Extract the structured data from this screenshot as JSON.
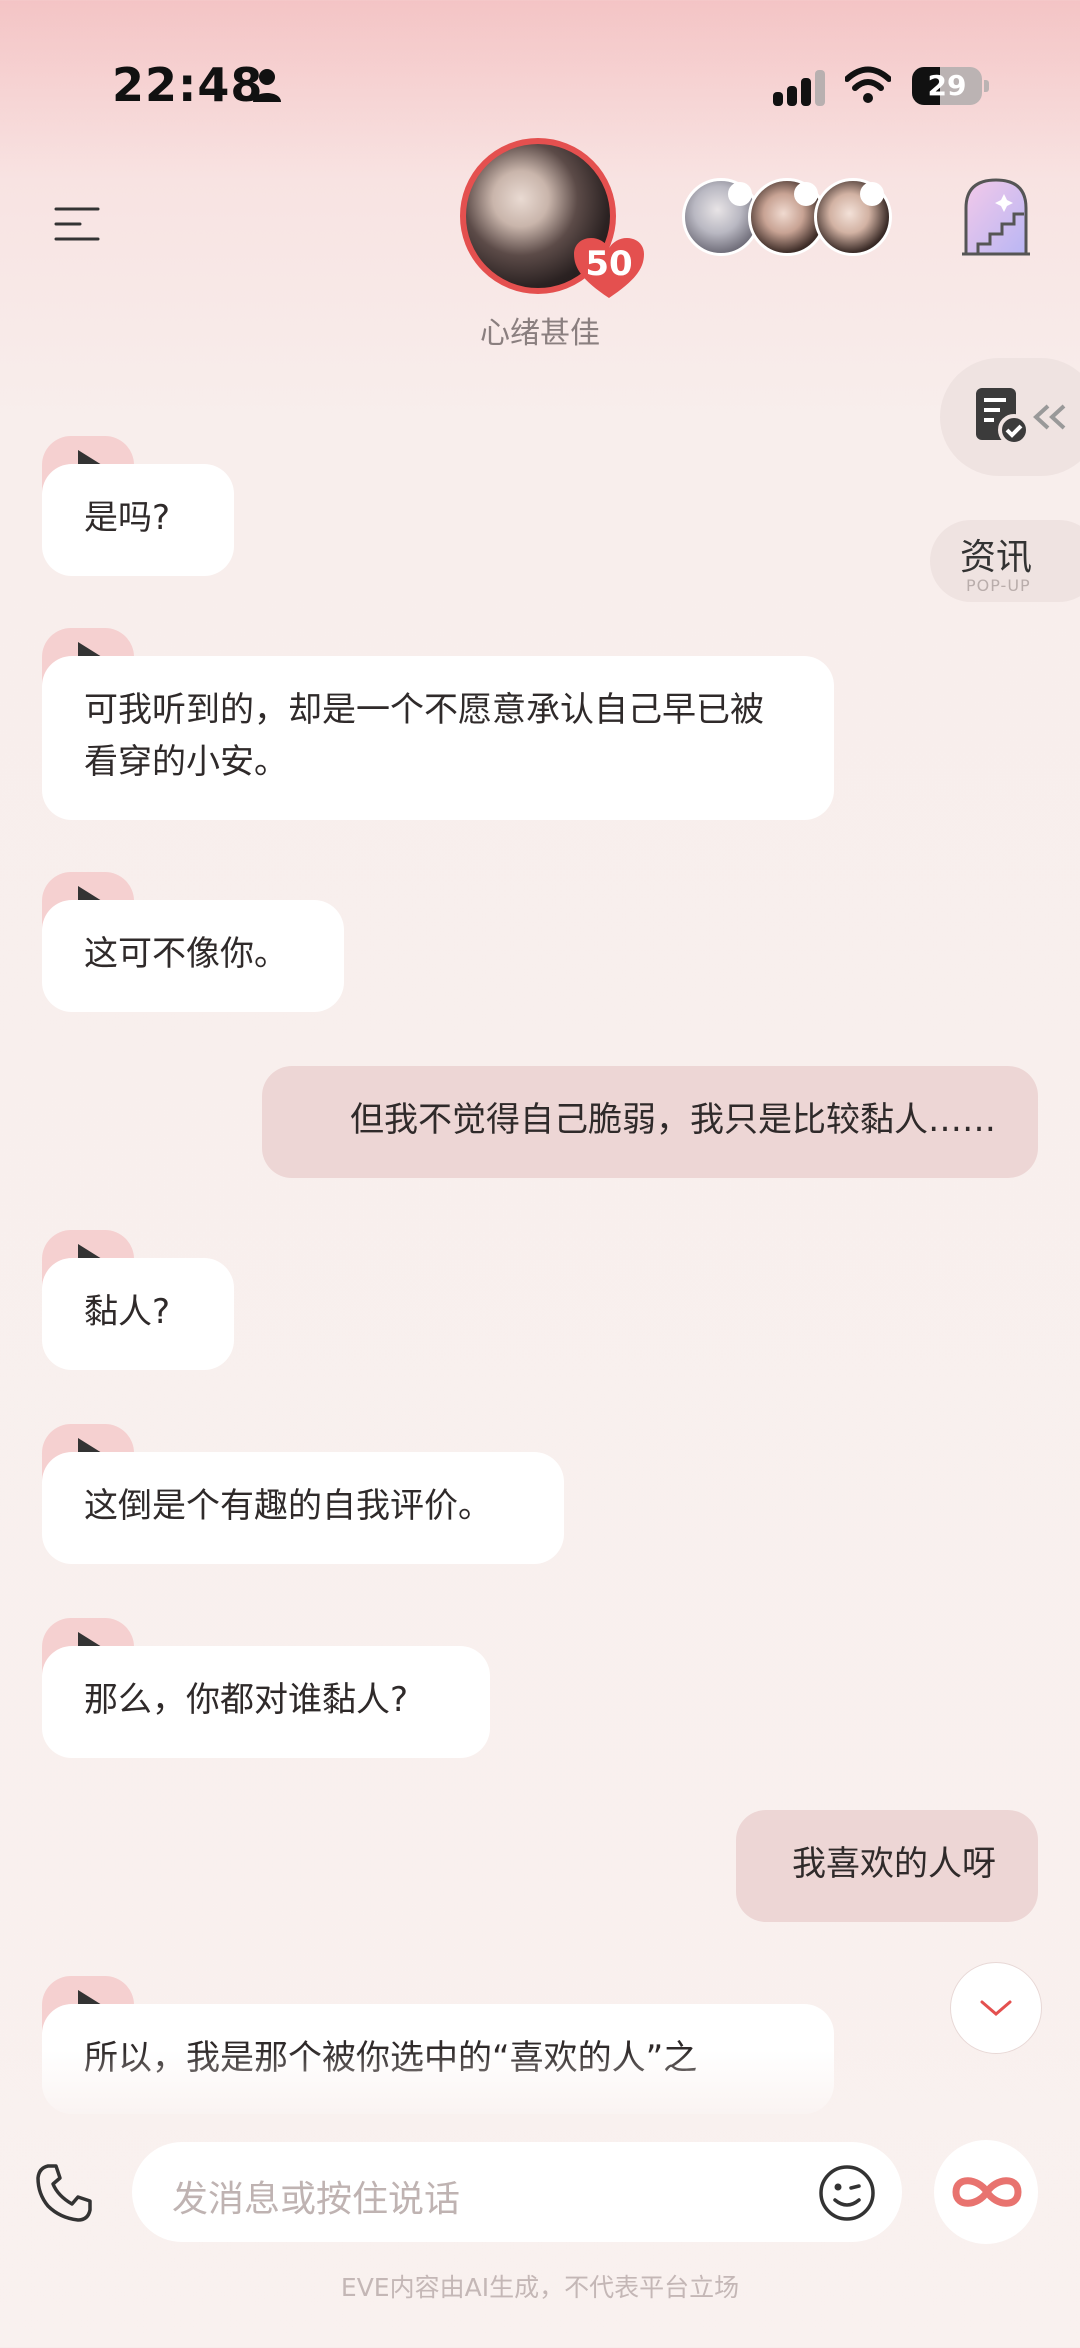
{
  "status_bar": {
    "time": "22:48",
    "battery": "29"
  },
  "header": {
    "affinity": "50",
    "mood": "心绪甚佳"
  },
  "side": {
    "news_label": "资讯",
    "news_sub": "POP-UP"
  },
  "messages": [
    {
      "role": "ai",
      "text": "是吗?"
    },
    {
      "role": "ai",
      "text": "可我听到的，却是一个不愿意承认自己早已被看穿的小安。"
    },
    {
      "role": "ai",
      "text": "这可不像你。"
    },
    {
      "role": "user",
      "text": "但我不觉得自己脆弱，我只是比较黏人……"
    },
    {
      "role": "ai",
      "text": "黏人?"
    },
    {
      "role": "ai",
      "text": "这倒是个有趣的自我评价。"
    },
    {
      "role": "ai",
      "text": "那么，你都对谁黏人?"
    },
    {
      "role": "user",
      "text": "我喜欢的人呀"
    },
    {
      "role": "ai",
      "text": "所以，我是那个被你选中的“喜欢的人”之"
    }
  ],
  "input": {
    "placeholder": "发消息或按住说话"
  },
  "footer": {
    "disclaimer": "EVE内容由AI生成，不代表平台立场"
  },
  "colors": {
    "accent": "#e4504f",
    "user_bubble": "#edd6d5",
    "play_tab": "#f5d0d0"
  }
}
